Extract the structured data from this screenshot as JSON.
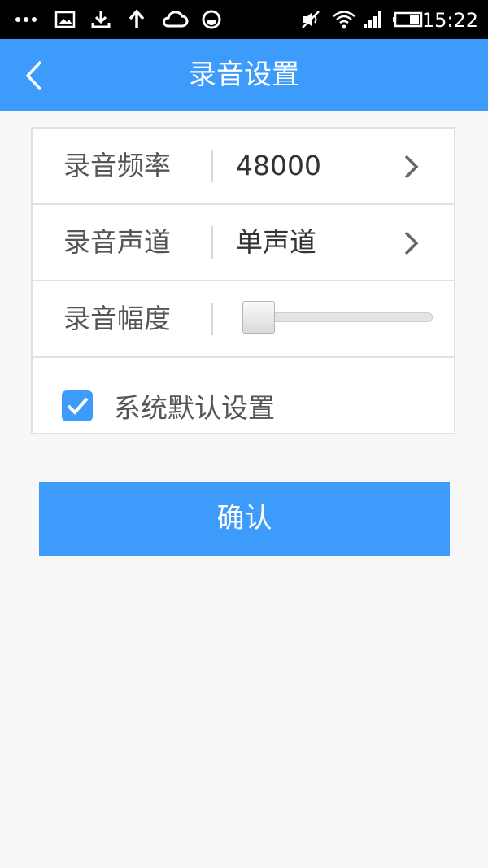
{
  "status_bar": {
    "time": "15:22",
    "left_icons": [
      "more-dots-icon",
      "image-icon",
      "download-icon",
      "upload-arrow-icon",
      "cloud-icon",
      "emoji-icon"
    ],
    "right_icons": [
      "mute-icon",
      "wifi-icon",
      "signal-icon",
      "battery-icon"
    ]
  },
  "app_bar": {
    "title": "录音设置",
    "back_icon": "chevron-left-icon"
  },
  "settings": {
    "frequency": {
      "label": "录音频率",
      "value": "48000"
    },
    "channel": {
      "label": "录音声道",
      "value": "单声道"
    },
    "amplitude": {
      "label": "录音幅度",
      "level": 0
    },
    "default_setting": {
      "label": "系统默认设置",
      "checked": true
    }
  },
  "confirm_label": "确认",
  "colors": {
    "primary": "#3d9bfb",
    "background": "#f7f7f7",
    "divider": "#e1e1e1"
  }
}
